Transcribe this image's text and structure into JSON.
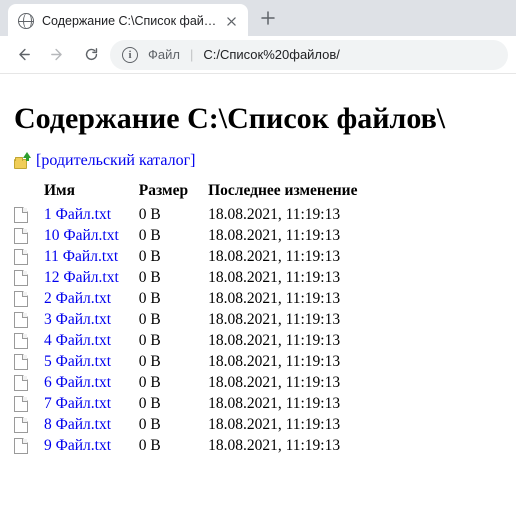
{
  "chrome": {
    "tab_title": "Содержание C:\\Список файлов",
    "omnibox_prefix": "Файл",
    "omnibox_path": "C:/Список%20файлов/"
  },
  "page": {
    "heading": "Содержание C:\\Список файлов\\",
    "parent_link": "[родительский каталог]"
  },
  "table": {
    "headers": {
      "name": "Имя",
      "size": "Размер",
      "modified": "Последнее изменение"
    },
    "rows": [
      {
        "name": "1 Файл.txt",
        "size": "0 B",
        "modified": "18.08.2021, 11:19:13"
      },
      {
        "name": "10 Файл.txt",
        "size": "0 B",
        "modified": "18.08.2021, 11:19:13"
      },
      {
        "name": "11 Файл.txt",
        "size": "0 B",
        "modified": "18.08.2021, 11:19:13"
      },
      {
        "name": "12 Файл.txt",
        "size": "0 B",
        "modified": "18.08.2021, 11:19:13"
      },
      {
        "name": "2 Файл.txt",
        "size": "0 B",
        "modified": "18.08.2021, 11:19:13"
      },
      {
        "name": "3 Файл.txt",
        "size": "0 B",
        "modified": "18.08.2021, 11:19:13"
      },
      {
        "name": "4 Файл.txt",
        "size": "0 B",
        "modified": "18.08.2021, 11:19:13"
      },
      {
        "name": "5 Файл.txt",
        "size": "0 B",
        "modified": "18.08.2021, 11:19:13"
      },
      {
        "name": "6 Файл.txt",
        "size": "0 B",
        "modified": "18.08.2021, 11:19:13"
      },
      {
        "name": "7 Файл.txt",
        "size": "0 B",
        "modified": "18.08.2021, 11:19:13"
      },
      {
        "name": "8 Файл.txt",
        "size": "0 B",
        "modified": "18.08.2021, 11:19:13"
      },
      {
        "name": "9 Файл.txt",
        "size": "0 B",
        "modified": "18.08.2021, 11:19:13"
      }
    ]
  }
}
